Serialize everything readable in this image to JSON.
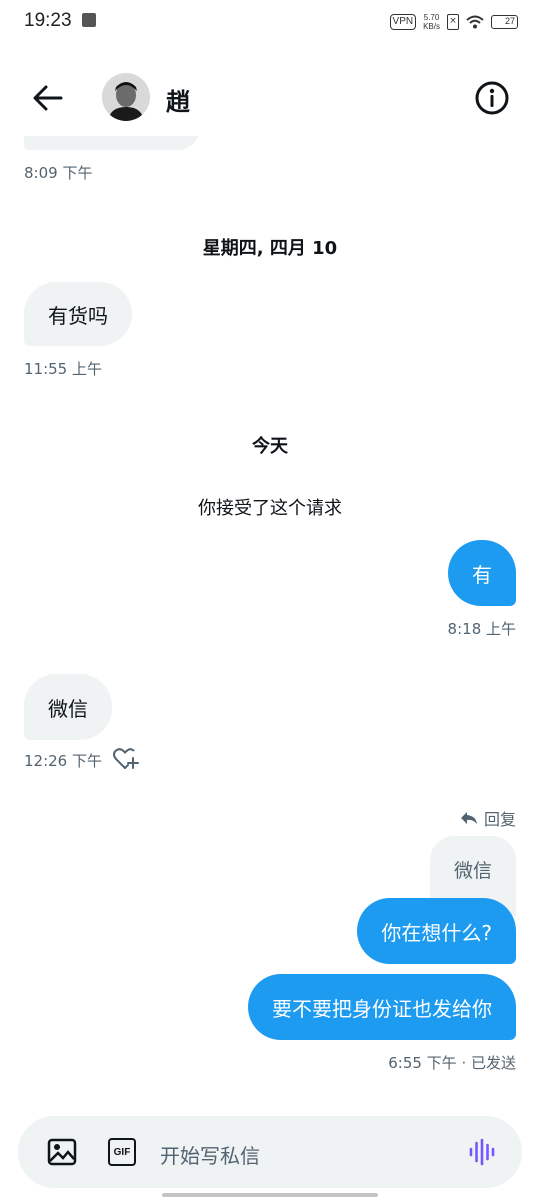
{
  "status_bar": {
    "time": "19:23",
    "vpn": "VPN",
    "speed_value": "5.70",
    "speed_unit": "KB/s",
    "battery": "27"
  },
  "header": {
    "contact_name": "趙"
  },
  "messages": {
    "prev_time": "8:09 下午",
    "date_divider": "星期四, 四月 10",
    "msg1_text": "有货吗",
    "msg1_time": "11:55 上午",
    "today_divider": "今天",
    "accepted_note": "你接受了这个请求",
    "msg2_text": "有",
    "msg2_time": "8:18 上午",
    "msg3_text": "微信",
    "msg3_time": "12:26 下午",
    "reply_label": "回复",
    "quoted_text": "微信",
    "msg4_text": "你在想什么?",
    "msg5_text": "要不要把身份证也发给你",
    "msg5_meta": "6:55 下午 · 已发送"
  },
  "composer": {
    "placeholder": "开始写私信",
    "gif_label": "GIF"
  },
  "colors": {
    "accent": "#1d9bf0",
    "incoming_bubble": "#eff3f4",
    "secondary_text": "#536471",
    "voice_icon": "#7856ff"
  }
}
